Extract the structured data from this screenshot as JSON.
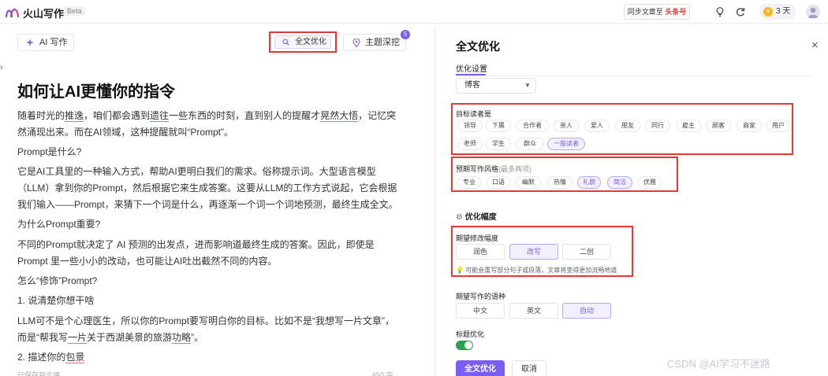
{
  "header": {
    "app_name": "火山写作",
    "beta": "Beta",
    "sync_prefix": "同步文章至",
    "sync_target": "头条号",
    "days_coin": "✦",
    "days": "3 天"
  },
  "toolbar": {
    "ai_write": "AI 写作",
    "full_opt": "全文优化",
    "topic": "主题深挖",
    "topic_badge": "5"
  },
  "doc": {
    "title": "如何让AI更懂你的指令",
    "p1_a": "随着时光的",
    "p1_b": "推逸",
    "p1_c": "，咱们都会遇到",
    "p1_d": "遗往",
    "p1_e": "一些东西的时刻，直到别人的提醒才",
    "p1_f": "晃然大悟",
    "p1_g": "，记忆突然涌现出来。而在AI领域，这种提醒就叫“Prompt”。",
    "q1": "Prompt是什么?",
    "p2": "它是AI工具里的一种输入方式，帮助AI更明白我们的需求。俗称提示词。大型语言模型（LLM）拿到你的Prompt，然后根据它来生成答案。这要从LLM的工作方式说起，它会根据我们输入——Prompt，来猜下一个词是什么，再逐渐一个词一个词地预测，最终生成全文。",
    "q2": "为什么Prompt重要?",
    "p3": "不同的Prompt就决定了 AI 预测的出发点，进而影响道最终生成的答案。因此，即使是 Prompt 里一些小小的改动，也可能让AI吐出截然不同的内容。",
    "q3": "怎么“修饰”Prompt?",
    "s1": "1. 说清楚你想干啥",
    "p4_a": "LLM可不是个心理医生，所以你的Prompt要写明白你的目标。比如不是“我想写一片文章”，而是“帮我写",
    "p4_b": "一片",
    "p4_c": "关于西湖美景的旅游",
    "p4_d": "功略",
    "p4_e": "”。",
    "s2_a": "2. 描述你的",
    "s2_b": "包景",
    "foot_left": "已保存到云端",
    "foot_right": "650 字"
  },
  "panel": {
    "title": "全文优化",
    "close": "×",
    "tab": "优化设置",
    "select_value": "博客",
    "readers_label": "目标读者是",
    "readers": [
      "领导",
      "下属",
      "合作者",
      "亲人",
      "爱人",
      "朋友",
      "同行",
      "雇主",
      "顾客",
      "商家",
      "用户",
      "老师",
      "学生",
      "群众",
      "一般读者"
    ],
    "readers_selected": [
      14
    ],
    "style_label": "预期写作风格",
    "style_sub": "(最多两项)",
    "styles": [
      "专业",
      "口语",
      "幽默",
      "热情",
      "礼貌",
      "简洁",
      "优雅"
    ],
    "styles_selected": [
      4,
      5
    ],
    "degree_title": "优化幅度",
    "degree_icon": "⚙",
    "degree_label": "期望修改幅度",
    "degrees": [
      "润色",
      "改写",
      "二创"
    ],
    "degree_selected": 1,
    "hint": "可能会重写部分句子或段落，文章将变得更加流畅地道",
    "lang_label": "期望写作的语种",
    "langs": [
      "中文",
      "英文",
      "自动"
    ],
    "lang_selected": 2,
    "title_opt": "标题优化",
    "primary": "全文优化",
    "cancel": "取消"
  },
  "watermark": "CSDN @AI学习不迷路"
}
